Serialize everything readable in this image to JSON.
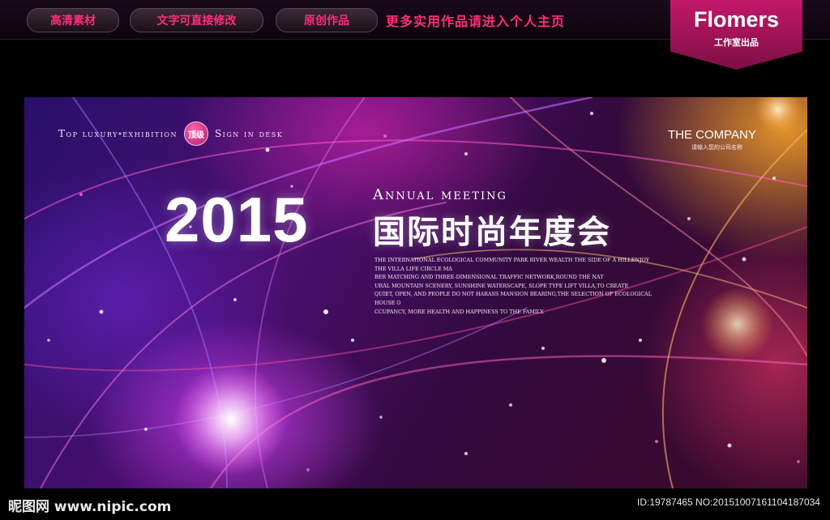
{
  "topbar": {
    "pills": [
      "高清素材",
      "文字可直接修改",
      "原创作品"
    ],
    "tagline": "更多实用作品请进入个人主页",
    "brand": {
      "name": "Flomers",
      "subtitle": "工作室出品"
    }
  },
  "banner": {
    "top_line": {
      "left": "Top luxury exhibition",
      "badge": "顶级",
      "right": "Sign in desk"
    },
    "company": {
      "name": "THE COMPANY",
      "subtitle": "请输入您的公司名称"
    },
    "year": "2015",
    "annual": "Annual meeting",
    "cn_title": "国际时尚年度会",
    "paragraph": [
      "THE INTERNATIONAL ECOLOGICAL COMMUNITY PARK RIVER WEALTH THE SIDE OF A HILLENJOY",
      "THE VILLA LIFE CIRCLE MA",
      "BER MATCHING AND THREE-DIMENSIONAL TRAFFIC NETWORK,ROUND THE NAT",
      "URAL MOUNTAIN SCENERY, SUNSHINE WATERSCAPE, SLOPE TYPE LIFT VILLA,TO CREATE",
      "QUIET, OPEN, AND PEOPLE DO NOT HARASS MANSION BEARING,THE SELECTION OF ECOLOGICAL HOUSE O",
      "CCUPANCY, MORE HEALTH AND HAPPINESS TO THE FAMILY."
    ]
  },
  "footer": {
    "site": "昵图网 www.nipic.com",
    "id_line": "ID:19787465 NO:20151007161104187034"
  },
  "colors": {
    "accent_pink": "#ff2d7a",
    "brand_magenta": "#c2186a"
  }
}
